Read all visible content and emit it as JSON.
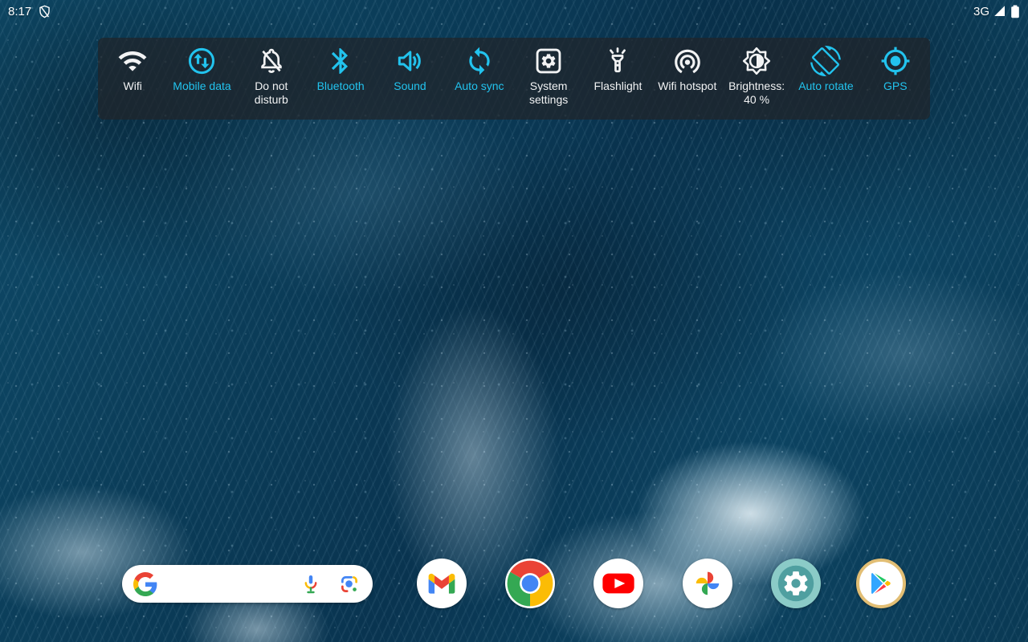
{
  "status_bar": {
    "time": "8:17",
    "network": "3G",
    "icons": [
      "trust-shield-icon",
      "signal-icon",
      "battery-icon"
    ]
  },
  "quick_settings": {
    "tiles": [
      {
        "label": "Wifi",
        "icon": "wifi-icon",
        "active": false
      },
      {
        "label": "Mobile data",
        "icon": "mobile-data-icon",
        "active": true
      },
      {
        "label": "Do not disturb",
        "icon": "do-not-disturb-icon",
        "active": false
      },
      {
        "label": "Bluetooth",
        "icon": "bluetooth-icon",
        "active": true
      },
      {
        "label": "Sound",
        "icon": "sound-icon",
        "active": true
      },
      {
        "label": "Auto sync",
        "icon": "auto-sync-icon",
        "active": true
      },
      {
        "label": "System settings",
        "icon": "system-settings-icon",
        "active": false
      },
      {
        "label": "Flashlight",
        "icon": "flashlight-icon",
        "active": false
      },
      {
        "label": "Wifi hotspot",
        "icon": "wifi-hotspot-icon",
        "active": false
      },
      {
        "label": "Brightness: 40 %",
        "icon": "brightness-icon",
        "active": false,
        "brightness_percent": 40
      },
      {
        "label": "Auto rotate",
        "icon": "auto-rotate-icon",
        "active": true
      },
      {
        "label": "GPS",
        "icon": "gps-icon",
        "active": true
      }
    ]
  },
  "dock": {
    "search": {
      "placeholder": "",
      "icons": [
        "google-logo",
        "voice-search-icon",
        "google-lens-icon"
      ]
    },
    "apps": [
      {
        "icon": "gmail-icon"
      },
      {
        "icon": "chrome-icon"
      },
      {
        "icon": "youtube-icon"
      },
      {
        "icon": "google-photos-icon"
      },
      {
        "icon": "settings-icon"
      },
      {
        "icon": "play-store-icon"
      }
    ]
  },
  "colors": {
    "accent": "#22c3ee",
    "inactive": "#f2f3f4",
    "qs_bar_background": "rgba(32,37,42,0.74)"
  }
}
